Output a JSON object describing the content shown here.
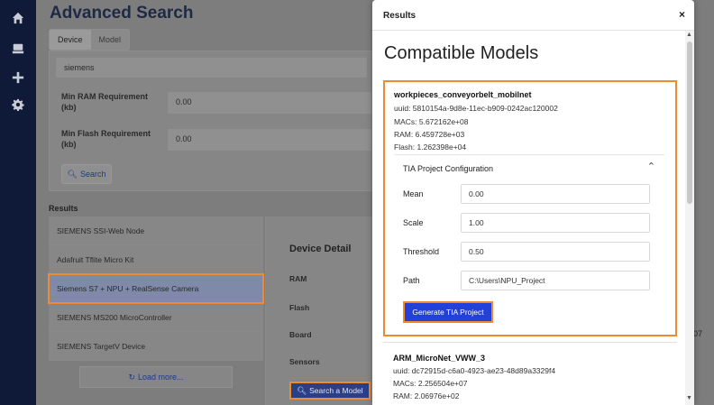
{
  "nav": {
    "icons": [
      "home-icon",
      "stack-icon",
      "plus-icon",
      "gear-icon"
    ]
  },
  "page": {
    "title": "Advanced Search",
    "tabs": [
      "Device",
      "Model"
    ],
    "search_value": "siemens",
    "min_ram_label": "Min RAM Requirement (kb)",
    "min_ram_value": "0.00",
    "min_flash_label": "Min Flash Requirement (kb)",
    "min_flash_value": "0.00",
    "search_button": "Search",
    "results_heading": "Results",
    "results": [
      "SIEMENS SSI-Web Node",
      "Adafruit Tflite Micro Kit",
      "Siemens S7 + NPU + RealSense Camera",
      "SIEMENS MS200 MicroController",
      "SIEMENS TargetV Device"
    ],
    "load_more": "Load more...",
    "detail_title": "Device Detail",
    "detail_fields": [
      "RAM",
      "Flash",
      "Board",
      "Sensors"
    ],
    "search_model_button": "Search a Model",
    "stray_text": "07"
  },
  "modal": {
    "header_title": "Results",
    "close": "×",
    "heading": "Compatible Models",
    "model1": {
      "name": "workpieces_conveyorbelt_mobilnet",
      "uuid": "uuid: 5810154a-9d8e-11ec-b909-0242ac120002",
      "macs": "MACs: 5.672162e+08",
      "ram": "RAM: 6.459728e+03",
      "flash": "Flash: 1.262398e+04",
      "config_title": "TIA Project Configuration",
      "fields": [
        {
          "label": "Mean",
          "value": "0.00"
        },
        {
          "label": "Scale",
          "value": "1.00"
        },
        {
          "label": "Threshold",
          "value": "0.50"
        },
        {
          "label": "Path",
          "value": "C:\\Users\\NPU_Project"
        }
      ],
      "generate_button": "Generate TIA Project"
    },
    "model2": {
      "name": "ARM_MicroNet_VWW_3",
      "uuid": "uuid: dc72915d-c6a0-4923-ae23-48d89a3329f4",
      "macs": "MACs: 2.256504e+07",
      "ram": "RAM: 2.06976e+02"
    }
  }
}
